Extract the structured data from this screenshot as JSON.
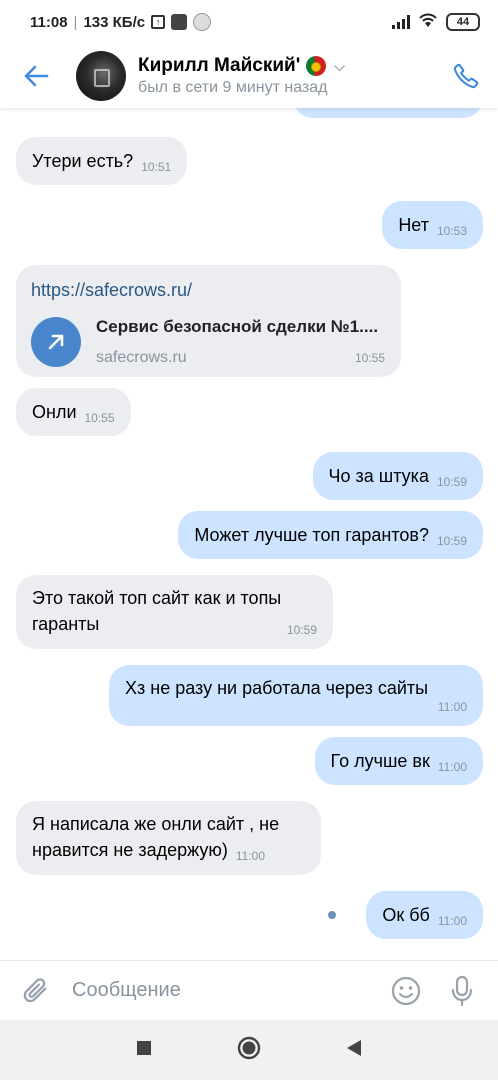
{
  "status_bar": {
    "time": "11:08",
    "speed": "133 КБ/с",
    "battery": "44"
  },
  "header": {
    "name": "Кирилл Майский'",
    "status": "был в сети 9 минут назад"
  },
  "messages": [
    {
      "text": "Утери есть?",
      "time": "10:51"
    },
    {
      "text": "Нет",
      "time": "10:53"
    },
    {
      "url": "https://safecrows.ru/",
      "title": "Сервис безопасной сделки №1....",
      "domain": "safecrows.ru",
      "time": "10:55"
    },
    {
      "text": "Онли",
      "time": "10:55"
    },
    {
      "text": "Чо за штука",
      "time": "10:59"
    },
    {
      "text": "Может лучше топ гарантов?",
      "time": "10:59"
    },
    {
      "text": "Это такой топ сайт как и топы гаранты",
      "time": "10:59"
    },
    {
      "text": "Хз не разу ни работала через сайты",
      "time": "11:00"
    },
    {
      "text": "Го лучше вк",
      "time": "11:00"
    },
    {
      "text": "Я написала же онли сайт , не нравится не задержую)",
      "time": "11:00"
    },
    {
      "text": "Ок бб",
      "time": "11:00"
    }
  ],
  "input": {
    "placeholder": "Сообщение"
  },
  "colors": {
    "accent": "#3f8ae0",
    "incoming_bubble": "#ebedf0",
    "outgoing_bubble": "#cce4ff"
  }
}
